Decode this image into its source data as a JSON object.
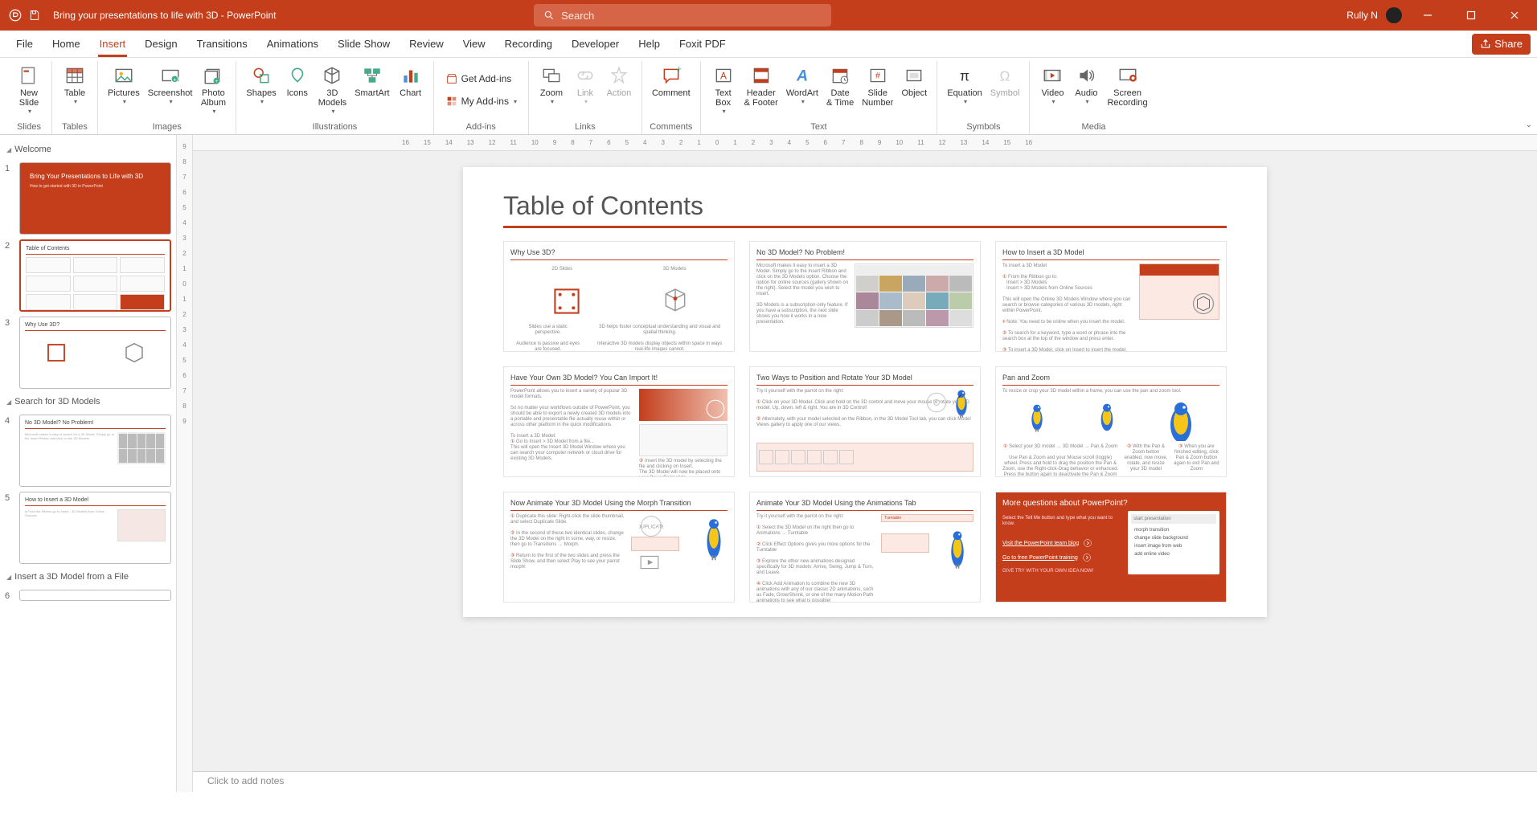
{
  "titlebar": {
    "doc_title": "Bring your presentations to life with 3D  -  PowerPoint",
    "search_placeholder": "Search",
    "user_name": "Rully N"
  },
  "tabs": {
    "file": "File",
    "home": "Home",
    "insert": "Insert",
    "design": "Design",
    "transitions": "Transitions",
    "animations": "Animations",
    "slideshow": "Slide Show",
    "review": "Review",
    "view": "View",
    "recording": "Recording",
    "developer": "Developer",
    "help": "Help",
    "foxit": "Foxit PDF",
    "share": "Share"
  },
  "active_tab": "insert",
  "ribbon": {
    "groups": {
      "slides": "Slides",
      "tables": "Tables",
      "images": "Images",
      "illustrations": "Illustrations",
      "addins": "Add-ins",
      "links": "Links",
      "comments": "Comments",
      "text": "Text",
      "symbols": "Symbols",
      "media": "Media"
    },
    "buttons": {
      "new_slide": "New\nSlide",
      "table": "Table",
      "pictures": "Pictures",
      "screenshot": "Screenshot",
      "photo_album": "Photo\nAlbum",
      "shapes": "Shapes",
      "icons": "Icons",
      "models3d": "3D\nModels",
      "smartart": "SmartArt",
      "chart": "Chart",
      "get_addins": "Get Add-ins",
      "my_addins": "My Add-ins",
      "zoom": "Zoom",
      "link": "Link",
      "action": "Action",
      "comment": "Comment",
      "text_box": "Text\nBox",
      "header_footer": "Header\n& Footer",
      "wordart": "WordArt",
      "date_time": "Date\n& Time",
      "slide_number": "Slide\nNumber",
      "object": "Object",
      "equation": "Equation",
      "symbol": "Symbol",
      "video": "Video",
      "audio": "Audio",
      "screen_recording": "Screen\nRecording"
    }
  },
  "ruler_marks_h": [
    "16",
    "15",
    "14",
    "13",
    "12",
    "11",
    "10",
    "9",
    "8",
    "7",
    "6",
    "5",
    "4",
    "3",
    "2",
    "1",
    "0",
    "1",
    "2",
    "3",
    "4",
    "5",
    "6",
    "7",
    "8",
    "9",
    "10",
    "11",
    "12",
    "13",
    "14",
    "15",
    "16"
  ],
  "ruler_marks_v": [
    "9",
    "8",
    "7",
    "6",
    "5",
    "4",
    "3",
    "2",
    "1",
    "0",
    "1",
    "2",
    "3",
    "4",
    "5",
    "6",
    "7",
    "8",
    "9"
  ],
  "sections": {
    "welcome": "Welcome",
    "search_models": "Search for 3D Models",
    "insert_from_file": "Insert a 3D Model from a File"
  },
  "thumbs": {
    "s1_title": "Bring Your Presentations to Life with 3D",
    "s1_sub": "How to get started with 3D in PowerPoint",
    "s2_title": "Table of Contents",
    "s3_title": "Why Use 3D?",
    "s4_title": "No 3D Model? No Problem!",
    "s5_title": "How to Insert a 3D Model"
  },
  "slide": {
    "title": "Table of Contents",
    "cards": [
      {
        "title": "Why Use 3D?",
        "left_h": "2D Slides",
        "right_h": "3D Models"
      },
      {
        "title": "No 3D Model? No Problem!"
      },
      {
        "title": "How to Insert a 3D Model"
      },
      {
        "title": "Have Your Own 3D Model? You Can Import It!"
      },
      {
        "title": "Two Ways to Position and Rotate Your 3D Model"
      },
      {
        "title": "Pan and Zoom"
      },
      {
        "title": "Now Animate Your 3D Model Using the Morph Transition"
      },
      {
        "title": "Animate Your 3D Model Using the Animations Tab"
      },
      {
        "title": "More questions about PowerPoint?",
        "sub": "Select the Tell Me button and type what you want to know.",
        "link1": "Visit the PowerPoint team blog",
        "link2": "Go to free PowerPoint training"
      }
    ]
  },
  "notes_placeholder": "Click to add notes"
}
